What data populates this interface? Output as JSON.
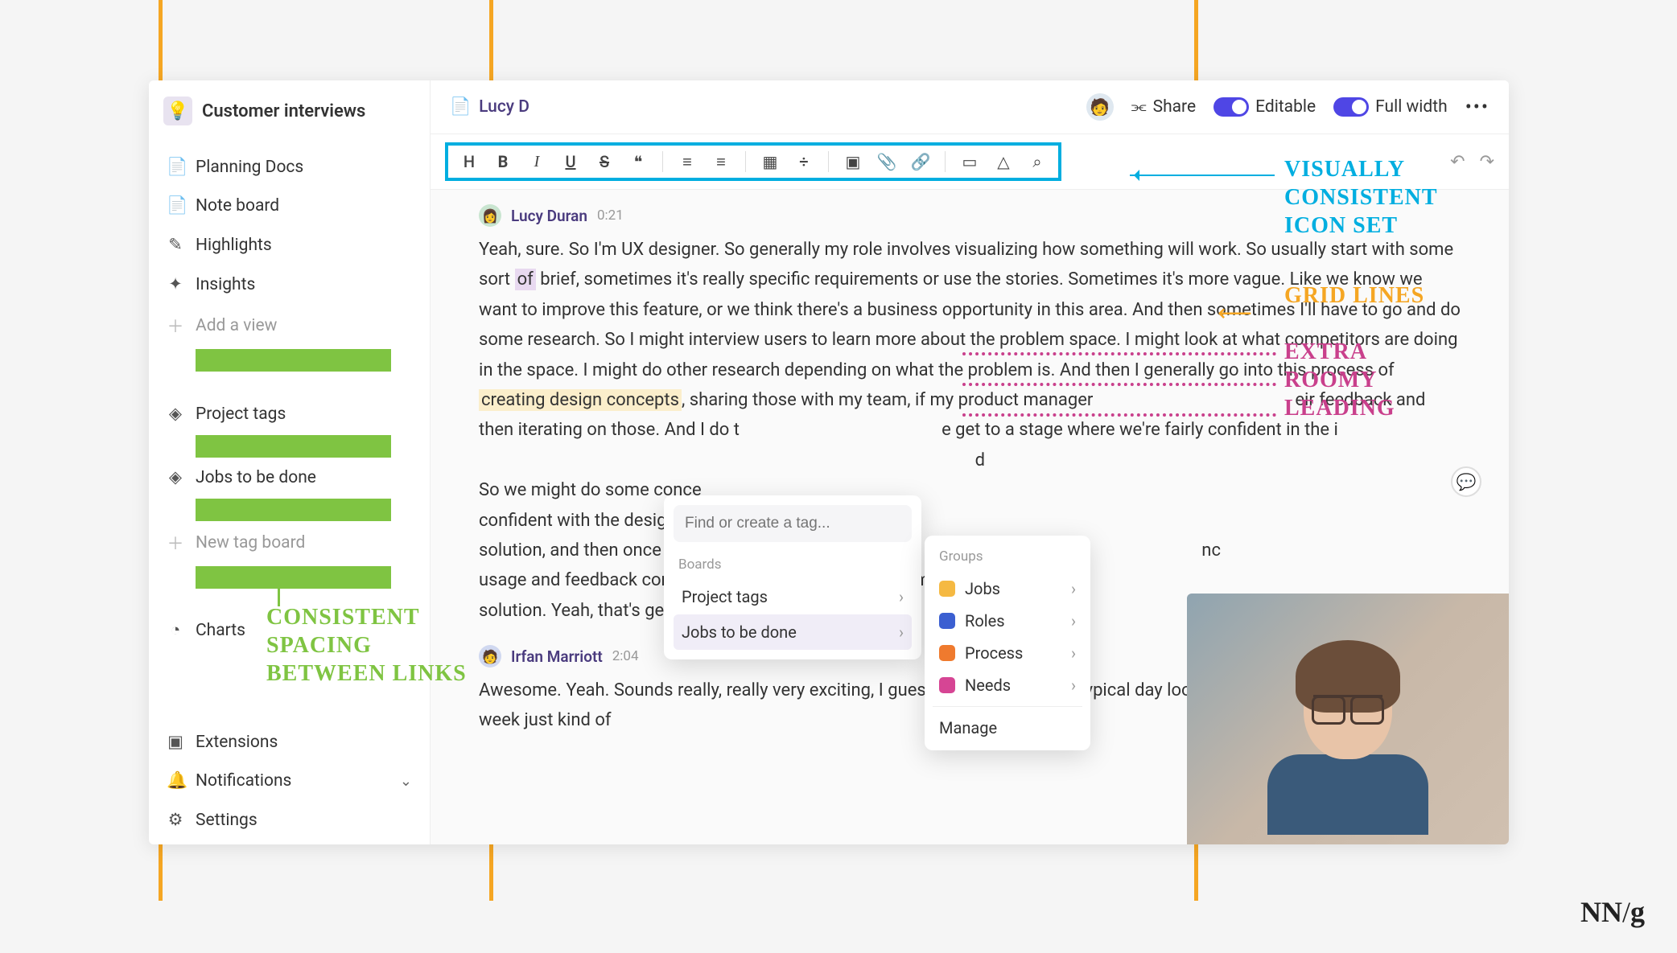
{
  "sidebar": {
    "title": "Customer interviews",
    "items": [
      {
        "icon": "📄",
        "label": "Planning Docs"
      },
      {
        "icon": "📄",
        "label": "Note board"
      },
      {
        "icon": "✎",
        "label": "Highlights"
      },
      {
        "icon": "✦",
        "label": "Insights"
      },
      {
        "icon": "＋",
        "label": "Add a view",
        "muted": true
      }
    ],
    "tags": [
      {
        "icon": "◈",
        "label": "Project tags"
      },
      {
        "icon": "◈",
        "label": "Jobs to be done"
      },
      {
        "icon": "＋",
        "label": "New tag board",
        "muted": true
      }
    ],
    "charts": {
      "icon": "◔",
      "label": "Charts"
    },
    "bottom": [
      {
        "icon": "▣",
        "label": "Extensions"
      },
      {
        "icon": "🔔",
        "label": "Notifications",
        "chevron": true
      },
      {
        "icon": "⚙",
        "label": "Settings"
      }
    ]
  },
  "header": {
    "doc_title": "Lucy D",
    "share": "Share",
    "editable": "Editable",
    "fullwidth": "Full width"
  },
  "toolbar": {
    "heading": "H",
    "bold": "B",
    "italic": "I",
    "underline": "U",
    "strike": "S",
    "quote": "❝",
    "ul": "≡",
    "ol": "≡",
    "table": "▦",
    "divider": "÷",
    "image": "▣",
    "attach": "📎",
    "link": "🔗",
    "video": "▭",
    "cloud": "△",
    "search": "⌕",
    "undo": "↶",
    "redo": "↷"
  },
  "transcript": {
    "speakers": [
      {
        "name": "Lucy Duran",
        "time": "0:21"
      },
      {
        "name": "Irfan Marriott",
        "time": "2:04"
      }
    ],
    "p1a": "Yeah, sure. So I'm UX designer. So generally my role involves visualizing how something will work. So usually start with some sort ",
    "p1_hl1": "of",
    "p1b": " brief, sometimes it's really specific requirements or use the stories. Sometimes it's more vague. Like we know we want to improve this feature, or we think there's a business opportunity in this area. And then sometimes I'll have to go and do some research. So I might interview users to learn more about the problem space. I might look at what competitors are doing in the space. I might do other research depending on what the problem is. And then I generally go into this process of ",
    "p1_hl2": "creating design concepts",
    "p1c": ", sharing those with my team, if my product manager",
    "p1d": "eir feedback and then iterating on those. And I do t",
    "p1e": "e get to a stage where we're fairly confident in the i",
    "p1f": "d",
    "p1g": "So we might do some conce",
    "p1h": "confident with the designs, c",
    "p1i": "solution, and then once it's c",
    "p1j": "nc",
    "p1k": "usage and feedback coming in and we can continue to improve",
    "p1l": "solution. Yeah, that's generally it.",
    "p2": "Awesome. Yeah. Sounds really, really very exciting, I guess. Cou.. you what a typical day looks like? It could be a, a day this week just kind of"
  },
  "popup": {
    "placeholder": "Find or create a tag...",
    "section": "Boards",
    "items": [
      {
        "label": "Project tags"
      },
      {
        "label": "Jobs to be done",
        "active": true
      }
    ]
  },
  "submenu": {
    "section": "Groups",
    "items": [
      {
        "color": "#f5b942",
        "label": "Jobs"
      },
      {
        "color": "#3b5fd1",
        "label": "Roles"
      },
      {
        "color": "#ef7a2e",
        "label": "Process"
      },
      {
        "color": "#d64594",
        "label": "Needs"
      }
    ],
    "manage": "Manage"
  },
  "annotations": {
    "icon_set_1": "VISUALLY",
    "icon_set_2": "CONSISTENT",
    "icon_set_3": "ICON SET",
    "grid": "GRID LINES",
    "leading_1": "EXTRA",
    "leading_2": "ROOMY",
    "leading_3": "LEADING",
    "spacing_1": "CONSISTENT",
    "spacing_2": "SPACING",
    "spacing_3": "BETWEEN LINKS"
  },
  "footer": {
    "nng": "NN/g"
  }
}
